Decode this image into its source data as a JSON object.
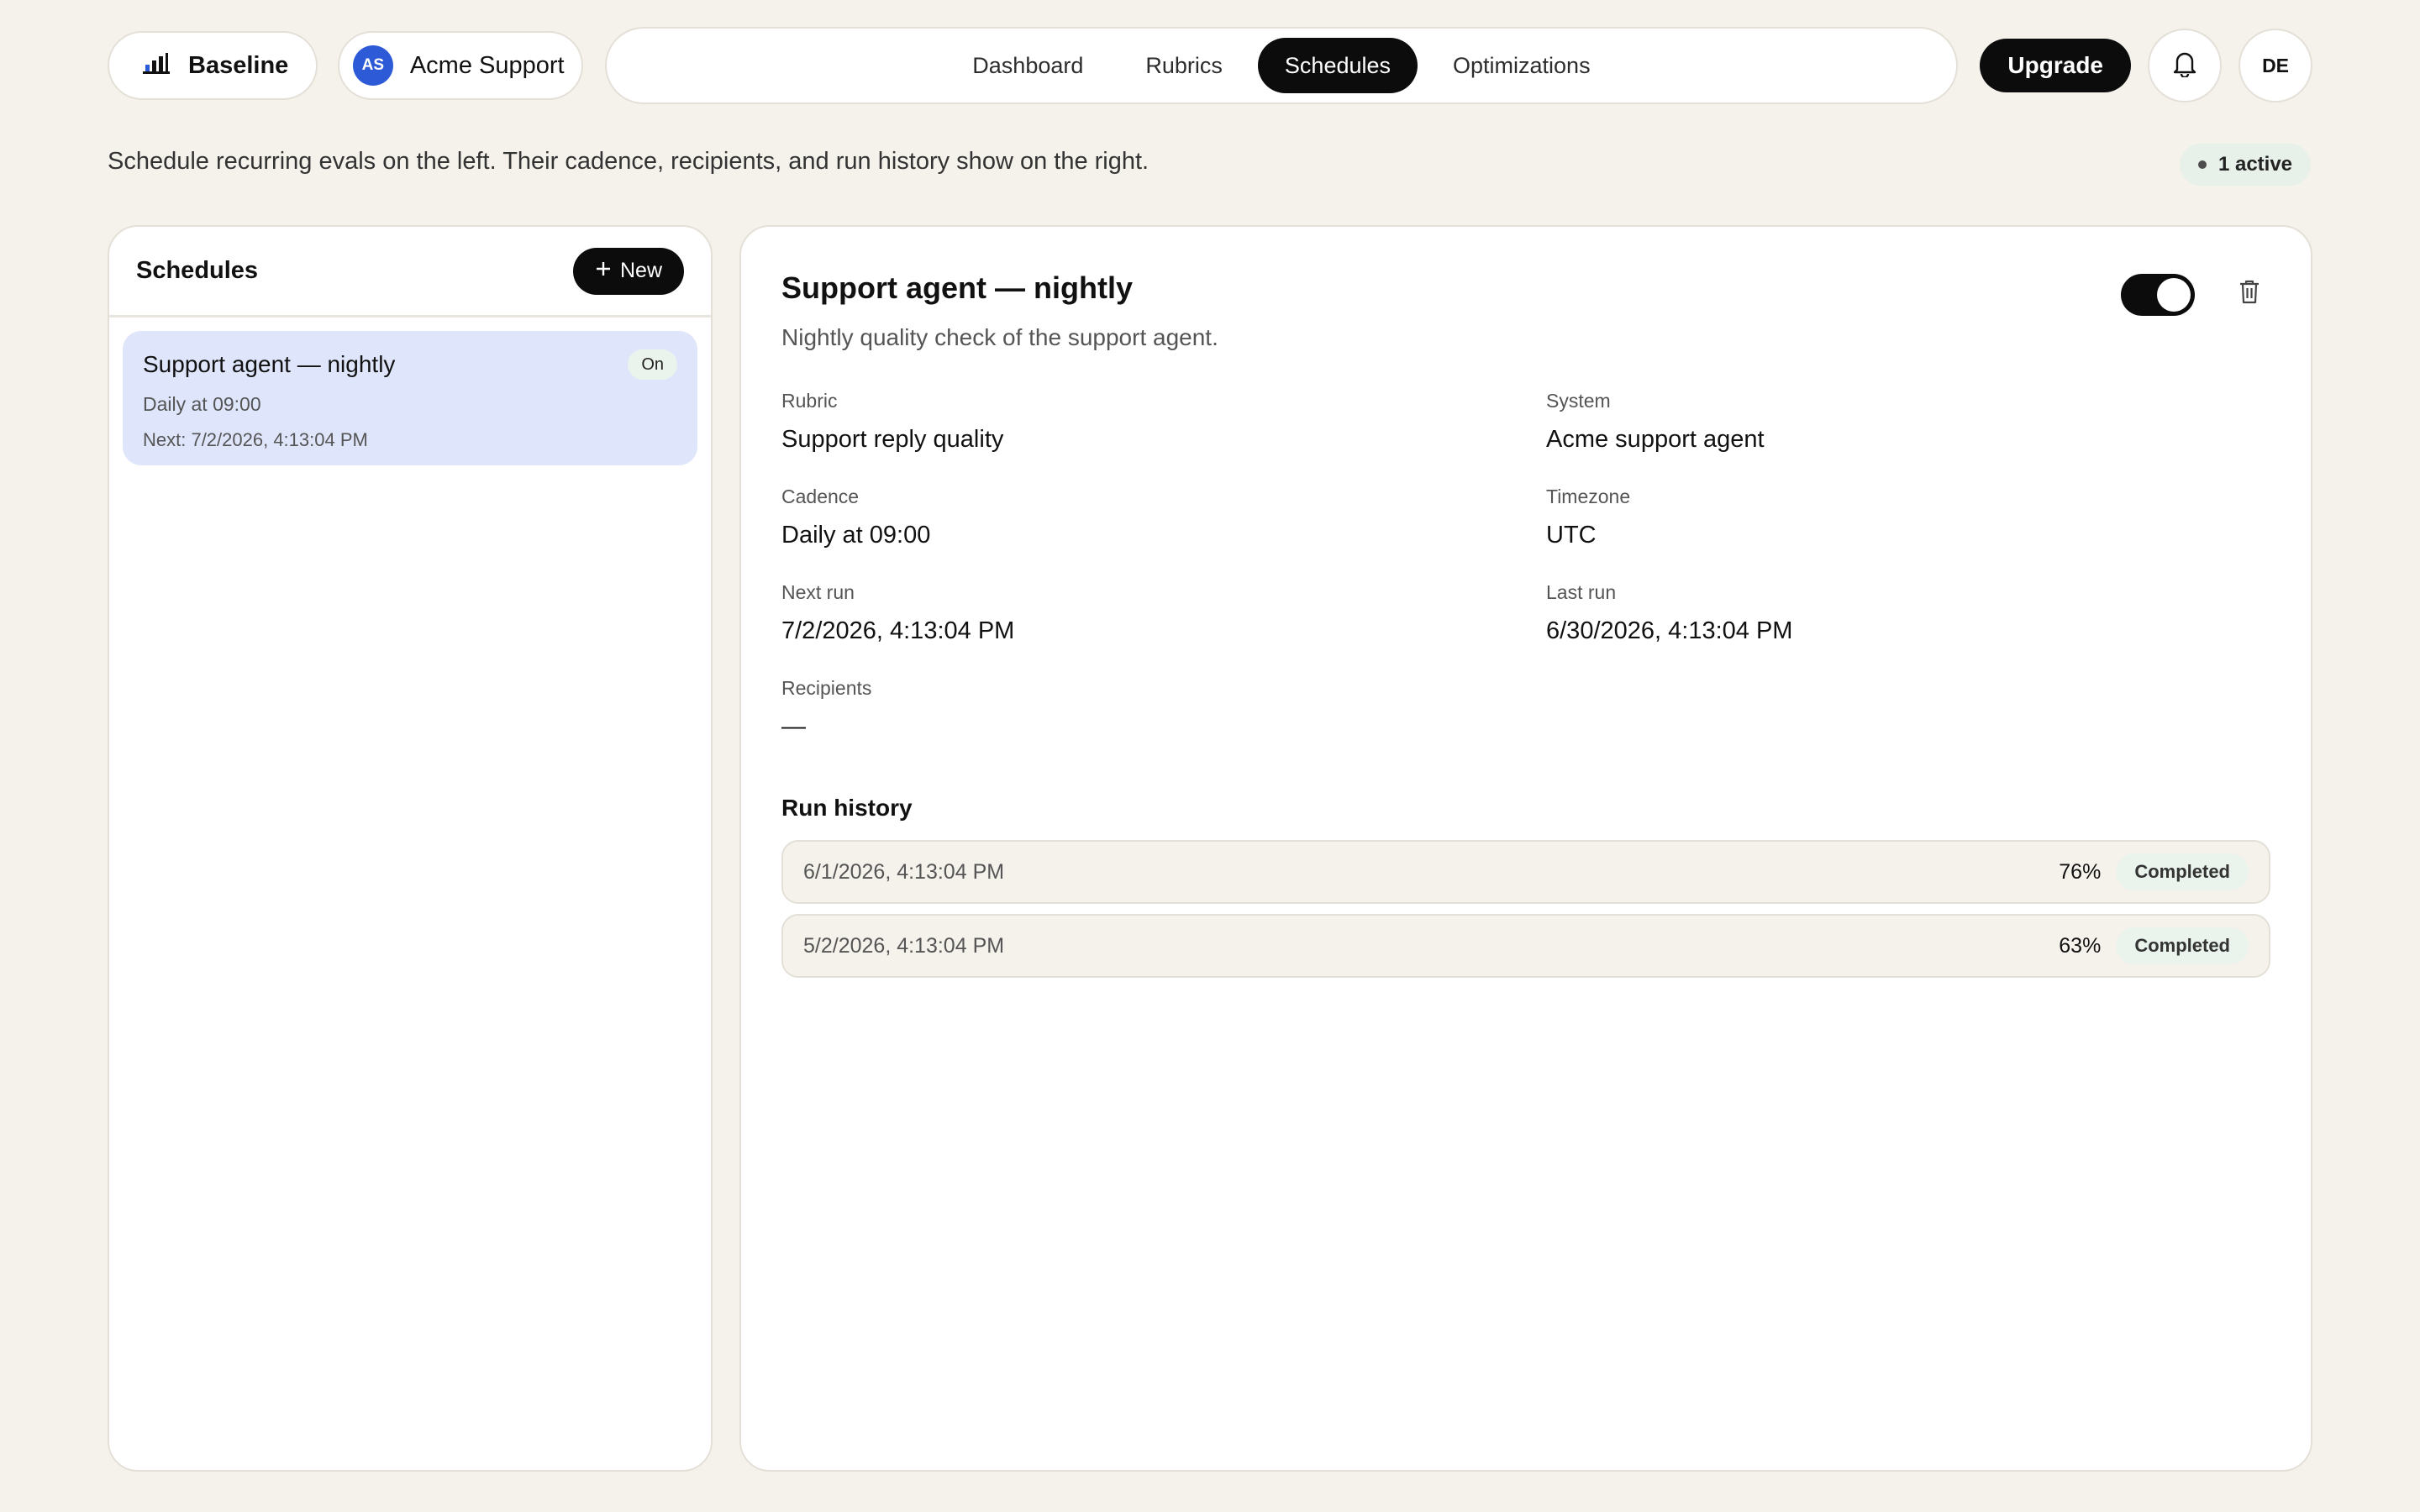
{
  "brand": {
    "name": "Baseline",
    "icon": "bar-chart-icon"
  },
  "org": {
    "initials": "AS",
    "name": "Acme Support",
    "avatar_color": "#2d5bd7"
  },
  "nav": {
    "tabs": [
      {
        "label": "Dashboard",
        "active": false
      },
      {
        "label": "Rubrics",
        "active": false
      },
      {
        "label": "Schedules",
        "active": true
      },
      {
        "label": "Optimizations",
        "active": false
      }
    ]
  },
  "header_actions": {
    "upgrade_label": "Upgrade",
    "notifications_icon": "bell-icon",
    "user_initials": "DE"
  },
  "page": {
    "subtitle": "Schedule recurring evals on the left. Their cadence, recipients, and run history show on the right.",
    "active_count": "1 active"
  },
  "schedules_panel": {
    "title": "Schedules",
    "new_label": "New",
    "items": [
      {
        "name": "Support agent — nightly",
        "cadence": "Daily at 09:00",
        "next": "Next: 7/2/2026, 4:13:04 PM",
        "status": "On",
        "selected": true
      }
    ]
  },
  "detail": {
    "title": "Support agent — nightly",
    "description": "Nightly quality check of the support agent.",
    "enabled": true,
    "fields": [
      {
        "label": "Rubric",
        "value": "Support reply quality"
      },
      {
        "label": "System",
        "value": "Acme support agent"
      },
      {
        "label": "Cadence",
        "value": "Daily at 09:00"
      },
      {
        "label": "Timezone",
        "value": "UTC"
      },
      {
        "label": "Next run",
        "value": "7/2/2026, 4:13:04 PM"
      },
      {
        "label": "Last run",
        "value": "6/30/2026, 4:13:04 PM"
      },
      {
        "label": "Recipients",
        "value": "—"
      }
    ],
    "history_title": "Run history",
    "runs": [
      {
        "date": "6/1/2026, 4:13:04 PM",
        "score": "76%",
        "status": "Completed"
      },
      {
        "date": "5/2/2026, 4:13:04 PM",
        "score": "63%",
        "status": "Completed"
      }
    ]
  },
  "colors": {
    "background": "#f5f2ec",
    "accent_dark": "#0c0c0c",
    "selected_item": "#dfe6fb",
    "status_green_bg": "#eaf3ec"
  }
}
